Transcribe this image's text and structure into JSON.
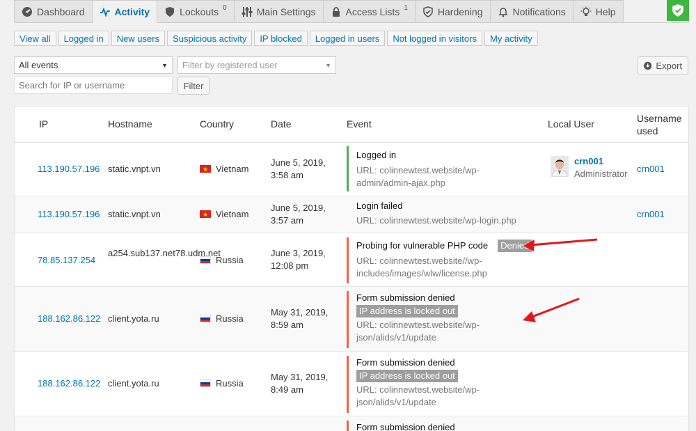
{
  "tabs": [
    {
      "label": "Dashboard",
      "sup": "",
      "icon": "dashboard-icon"
    },
    {
      "label": "Activity",
      "sup": "",
      "icon": "activity-icon"
    },
    {
      "label": "Lockouts",
      "sup": "0",
      "icon": "shield-icon"
    },
    {
      "label": "Main Settings",
      "sup": "",
      "icon": "sliders-icon"
    },
    {
      "label": "Access Lists",
      "sup": "1",
      "icon": "lock-icon"
    },
    {
      "label": "Hardening",
      "sup": "",
      "icon": "shield-check-icon"
    },
    {
      "label": "Notifications",
      "sup": "",
      "icon": "bell-icon"
    },
    {
      "label": "Help",
      "sup": "",
      "icon": "lightbulb-icon"
    }
  ],
  "filters": [
    "View all",
    "Logged in",
    "New users",
    "Suspicious activity",
    "IP blocked",
    "Logged in users",
    "Not logged in visitors",
    "My activity"
  ],
  "controls": {
    "events_select": "All events",
    "user_filter_placeholder": "Filter by registered user",
    "search_placeholder": "Search for IP or username",
    "filter_button": "Filter",
    "export_button": "Export"
  },
  "table": {
    "headers": {
      "ip": "IP",
      "hostname": "Hostname",
      "country": "Country",
      "date": "Date",
      "event": "Event",
      "local_user": "Local User",
      "username": "Username used"
    },
    "rows": [
      {
        "ip": "113.190.57.196",
        "hostname": "static.vnpt.vn",
        "country": "Vietnam",
        "date": "June 5, 2019, 3:58 am",
        "event": "Logged in",
        "tag": "",
        "url": "URL: colinnewtest.website/wp-admin/admin-ajax.php",
        "user": "crn001",
        "role": "Administrator",
        "username": "crn001"
      },
      {
        "ip": "113.190.57.196",
        "hostname": "static.vnpt.vn",
        "country": "Vietnam",
        "date": "June 5, 2019, 3:57 am",
        "event": "Login failed",
        "tag": "",
        "url": "URL: colinnewtest.website/wp-login.php",
        "user": "",
        "role": "",
        "username": "crn001"
      },
      {
        "ip": "78.85.137.254",
        "hostname": "a254.sub137.net78.udm.net",
        "country": "Russia",
        "date": "June 3, 2019, 12:08 pm",
        "event": "Probing for vulnerable PHP code",
        "tag": "Denied",
        "url": "URL: colinnewtest.website//wp-includes/images/wlw/license.php",
        "user": "",
        "role": "",
        "username": ""
      },
      {
        "ip": "188.162.86.122",
        "hostname": "client.yota.ru",
        "country": "Russia",
        "date": "May 31, 2019, 8:59 am",
        "event": "Form submission denied",
        "tag": "IP address is locked out",
        "url": "URL: colinnewtest.website/wp-json/alids/v1/update",
        "user": "",
        "role": "",
        "username": ""
      },
      {
        "ip": "188.162.86.122",
        "hostname": "client.yota.ru",
        "country": "Russia",
        "date": "May 31, 2019, 8:49 am",
        "event": "Form submission denied",
        "tag": "IP address is locked out",
        "url": "URL: colinnewtest.website/wp-json/alids/v1/update",
        "user": "",
        "role": "",
        "username": ""
      },
      {
        "ip": "",
        "hostname": "",
        "country": "",
        "date": "",
        "event": "Form submission denied",
        "tag": "",
        "url": "",
        "user": "",
        "role": "",
        "username": ""
      }
    ]
  },
  "colors": {
    "accent": "#0073aa",
    "success": "#4caf50",
    "danger": "#f0643c",
    "arrow": "#e8141b",
    "brand": "#3fb63f"
  }
}
